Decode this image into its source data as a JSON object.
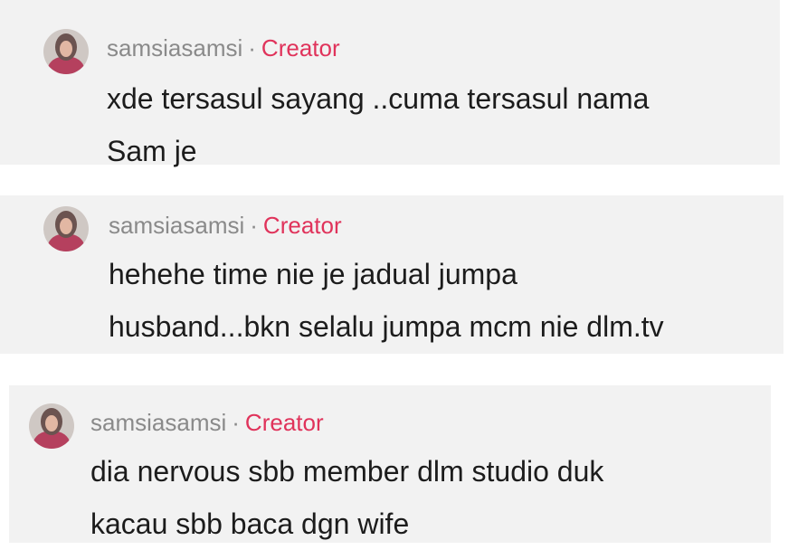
{
  "comments": [
    {
      "username": "samsiasamsi",
      "separator": "·",
      "badge": "Creator",
      "lines": [
        "xde tersasul sayang ..cuma tersasul nama",
        "Sam je"
      ]
    },
    {
      "username": "samsiasamsi",
      "separator": "·",
      "badge": "Creator",
      "lines": [
        "hehehe time nie je jadual jumpa",
        "husband...bkn selalu jumpa mcm nie dlm.tv"
      ]
    },
    {
      "username": "samsiasamsi",
      "separator": "·",
      "badge": "Creator",
      "lines": [
        "dia nervous sbb member dlm studio duk",
        "kacau sbb baca dgn wife"
      ]
    }
  ],
  "colors": {
    "card_bg": "#f2f2f2",
    "username": "#8a8a8a",
    "creator_badge": "#e0335b",
    "text": "#1c1c1c"
  },
  "icons": {
    "avatar": "profile-photo-avatar"
  }
}
